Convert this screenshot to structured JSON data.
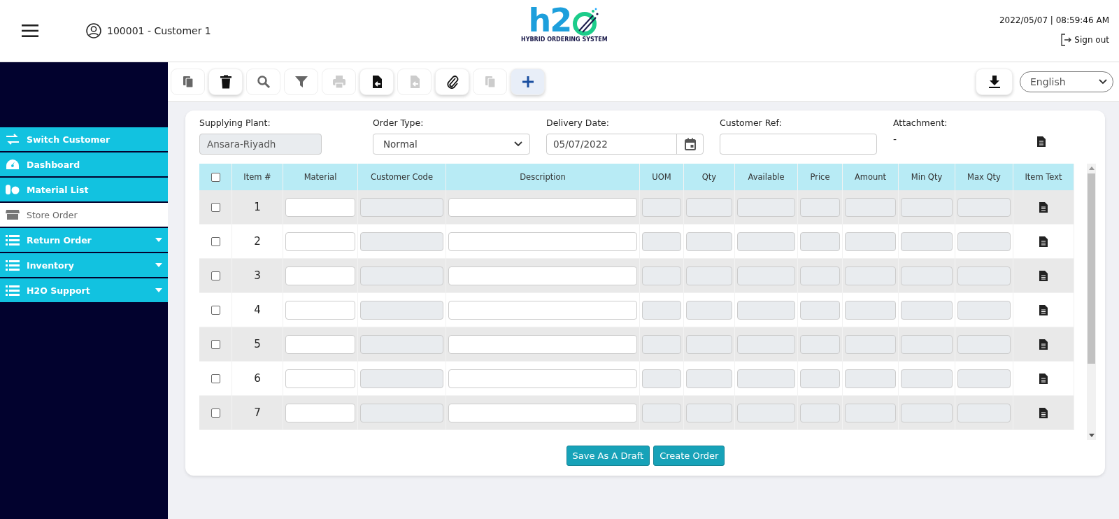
{
  "header": {
    "customer": "100001 - Customer 1",
    "logo_text": "h2",
    "logo_subtitle": "HYBRID ORDERING SYSTEM",
    "datetime": "2022/05/07 | 08:59:46 AM",
    "sign_out": "Sign out"
  },
  "sidebar": {
    "items": [
      {
        "label": "Switch Customer",
        "selected": false,
        "expandable": false
      },
      {
        "label": "Dashboard",
        "selected": false,
        "expandable": false
      },
      {
        "label": "Material List",
        "selected": false,
        "expandable": false
      },
      {
        "label": "Store Order",
        "selected": true,
        "expandable": false
      },
      {
        "label": "Return Order",
        "selected": false,
        "expandable": true
      },
      {
        "label": "Inventory",
        "selected": false,
        "expandable": true
      },
      {
        "label": "H2O Support",
        "selected": false,
        "expandable": true
      }
    ]
  },
  "toolbar": {
    "buttons": [
      {
        "kind": "copy",
        "disabled": false,
        "raised": false
      },
      {
        "kind": "delete",
        "disabled": false,
        "raised": true
      },
      {
        "kind": "search",
        "disabled": false,
        "raised": false
      },
      {
        "kind": "filter",
        "disabled": false,
        "raised": false
      },
      {
        "kind": "print",
        "disabled": true,
        "raised": false
      },
      {
        "kind": "import",
        "disabled": false,
        "raised": true
      },
      {
        "kind": "import",
        "disabled": true,
        "raised": false
      },
      {
        "kind": "attach",
        "disabled": false,
        "raised": true
      },
      {
        "kind": "copy",
        "disabled": true,
        "raised": false
      },
      {
        "kind": "add",
        "disabled": false,
        "raised": true
      }
    ],
    "language": "English"
  },
  "form": {
    "supplying_plant": {
      "label": "Supplying Plant:",
      "value": "Ansara-Riyadh"
    },
    "order_type": {
      "label": "Order Type:",
      "value": "Normal"
    },
    "delivery_date": {
      "label": "Delivery Date:",
      "value": "05/07/2022"
    },
    "customer_ref": {
      "label": "Customer Ref:"
    },
    "attachment": {
      "label": "Attachment:",
      "value": "-"
    }
  },
  "table": {
    "header_checked": false,
    "columns": [
      {
        "label": "Item #",
        "kind": "number"
      },
      {
        "label": "Material",
        "kind": "input"
      },
      {
        "label": "Customer Code",
        "kind": "readonly"
      },
      {
        "label": "Description",
        "kind": "input"
      },
      {
        "label": "UOM",
        "kind": "readonly"
      },
      {
        "label": "Qty",
        "kind": "readonly"
      },
      {
        "label": "Available",
        "kind": "readonly"
      },
      {
        "label": "Price",
        "kind": "readonly"
      },
      {
        "label": "Amount",
        "kind": "readonly"
      },
      {
        "label": "Min Qty",
        "kind": "readonly"
      },
      {
        "label": "Max Qty",
        "kind": "readonly"
      },
      {
        "label": "Item Text",
        "kind": "icon"
      }
    ],
    "rows": [
      {
        "item": "1",
        "checked": false
      },
      {
        "item": "2",
        "checked": false
      },
      {
        "item": "3",
        "checked": false
      },
      {
        "item": "4",
        "checked": false
      },
      {
        "item": "5",
        "checked": false
      },
      {
        "item": "6",
        "checked": false
      },
      {
        "item": "7",
        "checked": false
      }
    ]
  },
  "actions": [
    "Save As A Draft",
    "Create Order"
  ]
}
